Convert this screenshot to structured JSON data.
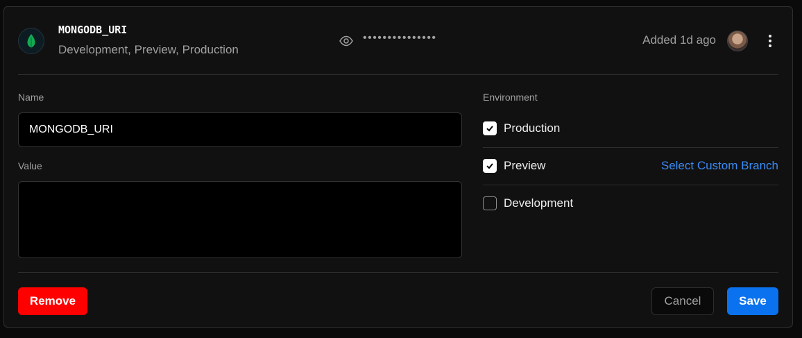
{
  "variable": {
    "name": "MONGODB_URI",
    "environments_summary": "Development, Preview, Production",
    "masked_value": "•••••••••••••••",
    "added": "Added 1d ago"
  },
  "form": {
    "name_label": "Name",
    "name_value": "MONGODB_URI",
    "value_label": "Value",
    "value_value": "",
    "environment_label": "Environment",
    "environments": [
      {
        "label": "Production",
        "checked": true
      },
      {
        "label": "Preview",
        "checked": true,
        "action": "Select Custom Branch"
      },
      {
        "label": "Development",
        "checked": false
      }
    ]
  },
  "buttons": {
    "remove": "Remove",
    "cancel": "Cancel",
    "save": "Save"
  },
  "icons": {
    "logo": "mongodb-leaf-icon",
    "reveal": "eye-icon",
    "menu": "more-vertical-icon",
    "check": "check-icon"
  },
  "colors": {
    "brand_leaf": "#13aa52",
    "danger": "#ff0000",
    "primary": "#0a72ef",
    "link": "#3b8bf5"
  }
}
